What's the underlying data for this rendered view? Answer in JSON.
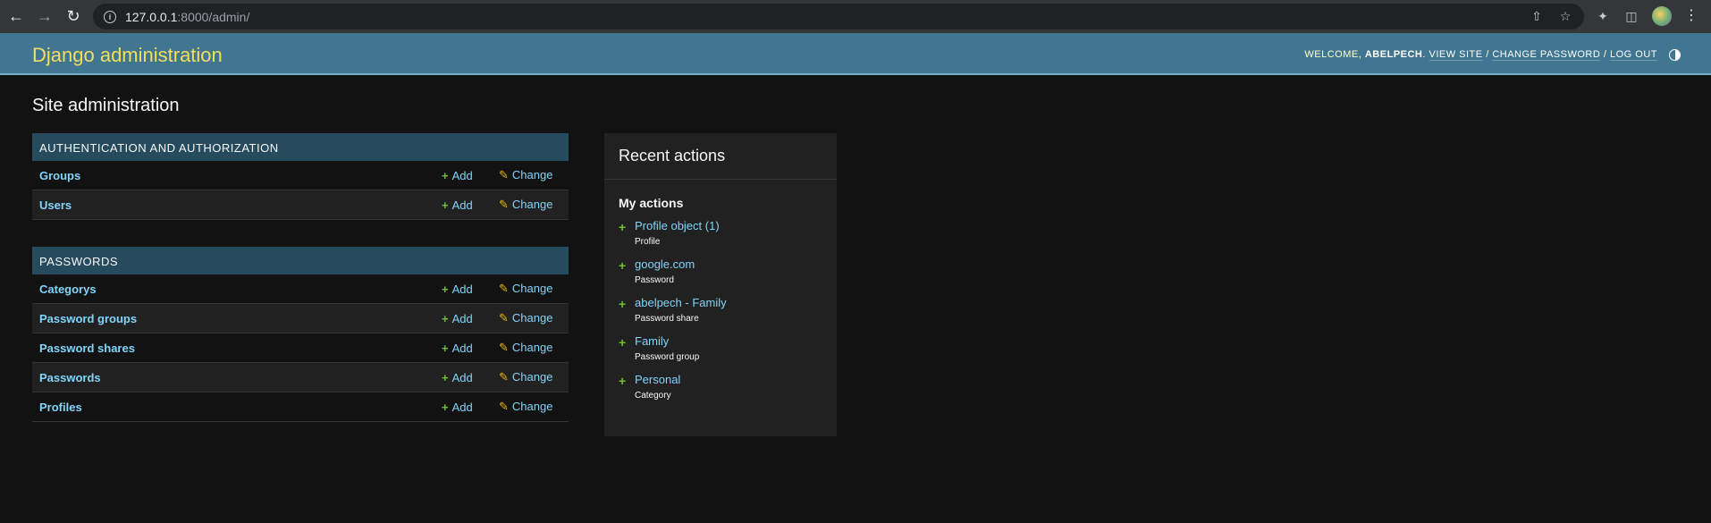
{
  "browser": {
    "url_host": "127.0.0.1",
    "url_rest": ":8000/admin/"
  },
  "header": {
    "brand": "Django administration",
    "welcome": "Welcome,",
    "username": "abelpech",
    "view_site": "View site",
    "change_password": "Change password",
    "log_out": "Log out",
    "sep": "/"
  },
  "page": {
    "title": "Site administration"
  },
  "modules": [
    {
      "caption": "Authentication and Authorization",
      "models": [
        "Groups",
        "Users"
      ]
    },
    {
      "caption": "Passwords",
      "models": [
        "Categorys",
        "Password groups",
        "Password shares",
        "Passwords",
        "Profiles"
      ]
    }
  ],
  "labels": {
    "add": "Add",
    "change": "Change"
  },
  "recent": {
    "title": "Recent actions",
    "my_actions": "My actions",
    "items": [
      {
        "object": "Profile object (1)",
        "type": "Profile"
      },
      {
        "object": "google.com",
        "type": "Password"
      },
      {
        "object": "abelpech - Family",
        "type": "Password share"
      },
      {
        "object": "Family",
        "type": "Password group"
      },
      {
        "object": "Personal",
        "type": "Category"
      }
    ]
  }
}
